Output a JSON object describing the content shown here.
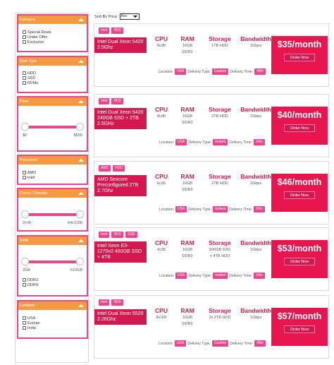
{
  "sidebar": {
    "category": {
      "title": "Category",
      "options": [
        "Special Deals",
        "Under Offer",
        "Exclusive"
      ]
    },
    "disk_type": {
      "title": "Disk Type",
      "options": [
        "HDD",
        "SSD",
        "NVMe"
      ]
    },
    "price": {
      "title": "Price",
      "min_label": "$0",
      "max_label": "$500"
    },
    "processor": {
      "title": "Processor",
      "options": [
        "AMD",
        "Intel"
      ]
    },
    "cores": {
      "title": "Cores / Threads",
      "min_label": "2c/4t",
      "max_label": "64c/128t"
    },
    "ram": {
      "title": "RAM",
      "min_label": "2GB",
      "max_label": "512GB",
      "options": [
        "DDR3",
        "DDR4"
      ]
    },
    "location": {
      "title": "Location",
      "options": [
        "USA",
        "Europe",
        "India"
      ]
    }
  },
  "sort": {
    "label": "Sort By Price:",
    "value": "Asc"
  },
  "spec_headers": {
    "cpu": "CPU",
    "ram": "RAM",
    "storage": "Storage",
    "bandwidth": "Bandwidth"
  },
  "meta_labels": {
    "location": "Location:",
    "delivery_type": "Delivery Type:",
    "delivery_time": "Delivery Time:"
  },
  "order_label": "Order Now",
  "servers": [
    {
      "tags": [
        "Intel",
        "HDD"
      ],
      "title": "Intel Dual Xeon 5420 2.5Ghz",
      "cpu": "8c/8t",
      "ram": [
        "16GB",
        "DDR3"
      ],
      "storage": [
        "1TB HDD"
      ],
      "bandwidth": "1Gbps",
      "location": "USA",
      "delivery_type": "Custom",
      "delivery_time": "48hr",
      "price": "$35/month"
    },
    {
      "tags": [
        "Intel",
        "HDD"
      ],
      "title": "Intel Dual Xeon 5420 240GB SSD + 2TB 2.5GHz",
      "cpu": "8c/8t",
      "ram": [
        "16GB",
        "DDR3"
      ],
      "storage": [
        "2TB HDD"
      ],
      "bandwidth": "1Gbps",
      "location": "USA",
      "delivery_type": "Instant",
      "delivery_time": "24hr",
      "price": "$40/month"
    },
    {
      "tags": [
        "AMD",
        "HDD"
      ],
      "title": "AMD Sexcore Preconfigured 2TB 2.7Ghz",
      "cpu": "6c/6t",
      "ram": [
        "16GB",
        "DDR3"
      ],
      "storage": [
        "2TB HDD"
      ],
      "bandwidth": "1Gbps",
      "location": "USA",
      "delivery_type": "Instant",
      "delivery_time": "24hr",
      "price": "$46/month"
    },
    {
      "tags": [
        "Intel",
        "HDD",
        "SSD"
      ],
      "title": "Intel Xeon E3-1270v2 480GB SSD + 4TB",
      "cpu": "4c/8t",
      "ram": [
        "16GB",
        "DDR3"
      ],
      "storage": [
        "500GB SSD",
        "+ 4TB HDD"
      ],
      "bandwidth": "1Gbps",
      "location": "USA",
      "delivery_type": "Instant",
      "delivery_time": "24hr",
      "price": "$53/month"
    },
    {
      "tags": [
        "Intel",
        "HDD"
      ],
      "title": "Intel Dual Xeon 5520 2.26Ghz",
      "cpu": "8c/16t",
      "ram": [
        "16GB",
        "DDR3"
      ],
      "storage": [
        "2x 2TB HDD"
      ],
      "bandwidth": "1Gbps",
      "location": "USA",
      "delivery_type": "Custom",
      "delivery_time": "48hr",
      "price": "$57/month"
    }
  ]
}
